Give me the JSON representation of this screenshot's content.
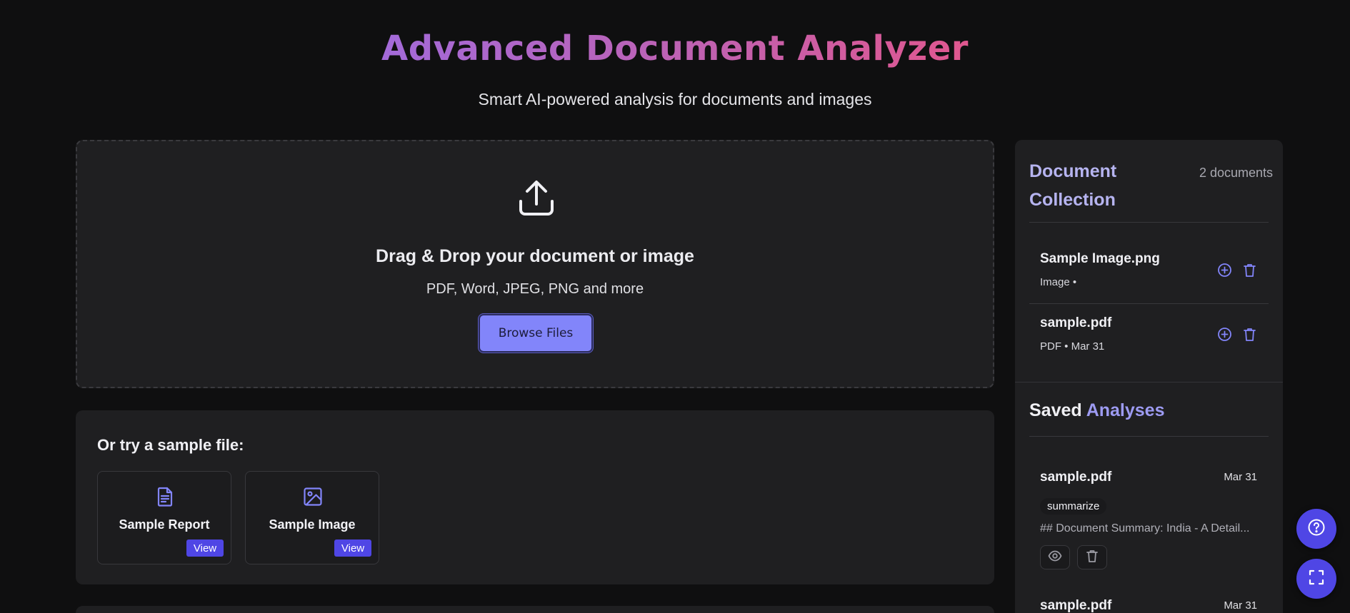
{
  "header": {
    "title": "Advanced Document Analyzer",
    "subtitle": "Smart AI-powered analysis for documents and images"
  },
  "upload": {
    "title": "Drag & Drop your document or image",
    "formats": "PDF, Word, JPEG, PNG and more",
    "browse_label": "Browse Files",
    "icon": "upload-icon"
  },
  "samples": {
    "title": "Or try a sample file:",
    "items": [
      {
        "label": "Sample Report",
        "icon": "document-icon",
        "view_label": "View"
      },
      {
        "label": "Sample Image",
        "icon": "image-icon",
        "view_label": "View"
      }
    ]
  },
  "collection": {
    "title": "Document Collection",
    "count": "2 documents",
    "items": [
      {
        "name": "Sample Image.png",
        "meta": "Image •"
      },
      {
        "name": "sample.pdf",
        "meta": "PDF • Mar 31"
      }
    ]
  },
  "saved": {
    "title_prefix": "Saved",
    "title_accent": "Analyses",
    "items": [
      {
        "name": "sample.pdf",
        "date": "Mar 31",
        "tag": "summarize",
        "preview": "## Document Summary: India - A Detail..."
      },
      {
        "name": "sample.pdf",
        "date": "Mar 31"
      }
    ]
  },
  "fabs": [
    "help-icon",
    "fullscreen-icon"
  ],
  "colors": {
    "accent": "#8285fa",
    "badge": "#4f46e5",
    "title_gradient_start": "#a36ad9",
    "title_gradient_end": "#e0578f",
    "background": "#0f0f10",
    "panel": "#1f1f21"
  }
}
